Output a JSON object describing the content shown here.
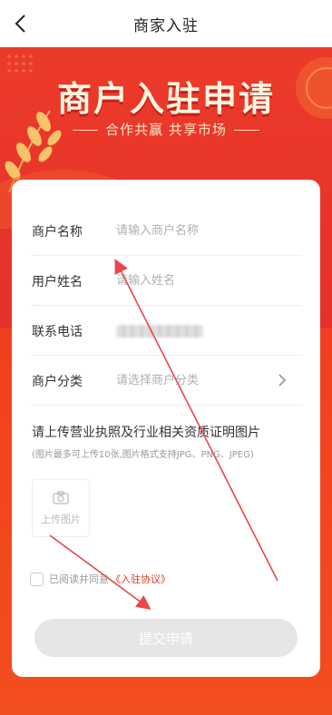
{
  "nav": {
    "title": "商家入驻"
  },
  "banner": {
    "title": "商户入驻申请",
    "subtitle": "合作共赢  共享市场"
  },
  "form": {
    "rows": [
      {
        "label": "商户名称",
        "placeholder": "请输入商户名称"
      },
      {
        "label": "用户姓名",
        "placeholder": "请输入姓名"
      },
      {
        "label": "联系电话",
        "placeholder": ""
      },
      {
        "label": "商户分类",
        "placeholder": "请选择商户分类"
      }
    ],
    "upload_title": "请上传营业执照及行业相关资质证明图片",
    "upload_hint": "(图片最多可上传10张,图片格式支持JPG、PNG、JPEG)",
    "upload_button_label": "上传图片",
    "agreement_text": "已阅读并同意",
    "agreement_link": "《入驻协议》",
    "submit_label": "提交申请"
  },
  "colors": {
    "brand_red": "#e8352a",
    "link_red": "#e33c2d",
    "disabled_button": "#e6e6e6"
  },
  "icons": [
    "back-arrow-icon",
    "chevron-right-icon",
    "camera-icon",
    "wheat-decoration",
    "annotation-arrow"
  ]
}
